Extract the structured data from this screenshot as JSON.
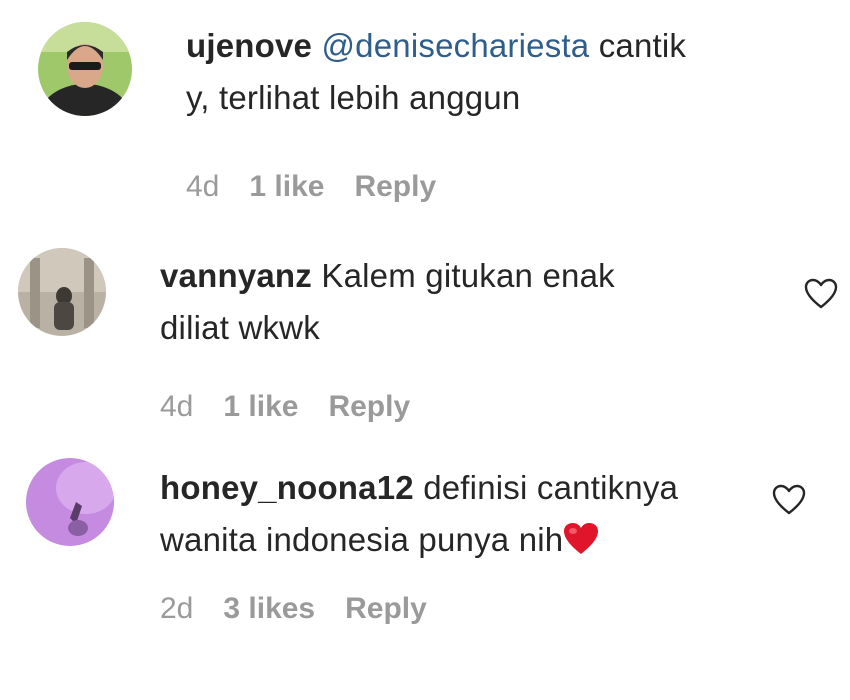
{
  "comments": [
    {
      "username": "ujenove",
      "mention": "@denisechariesta",
      "text_line1": "cantik",
      "text_line2": "y, terlihat lebih anggun",
      "time": "4d",
      "likes": "1 like",
      "reply": "Reply"
    },
    {
      "username": "vannyanz",
      "text_line1": "Kalem gitukan enak",
      "text_line2": "diliat wkwk",
      "time": "4d",
      "likes": "1 like",
      "reply": "Reply"
    },
    {
      "username": "honey_noona12",
      "text_line1": "definisi cantiknya",
      "text_line2": "wanita indonesia punya nih",
      "emoji": "red-heart-emoji",
      "time": "2d",
      "likes": "3 likes",
      "reply": "Reply"
    }
  ],
  "colors": {
    "text": "#262626",
    "meta": "#9a9a9a",
    "mention": "#2f5d8c",
    "heart_emoji": "#e0142a"
  }
}
